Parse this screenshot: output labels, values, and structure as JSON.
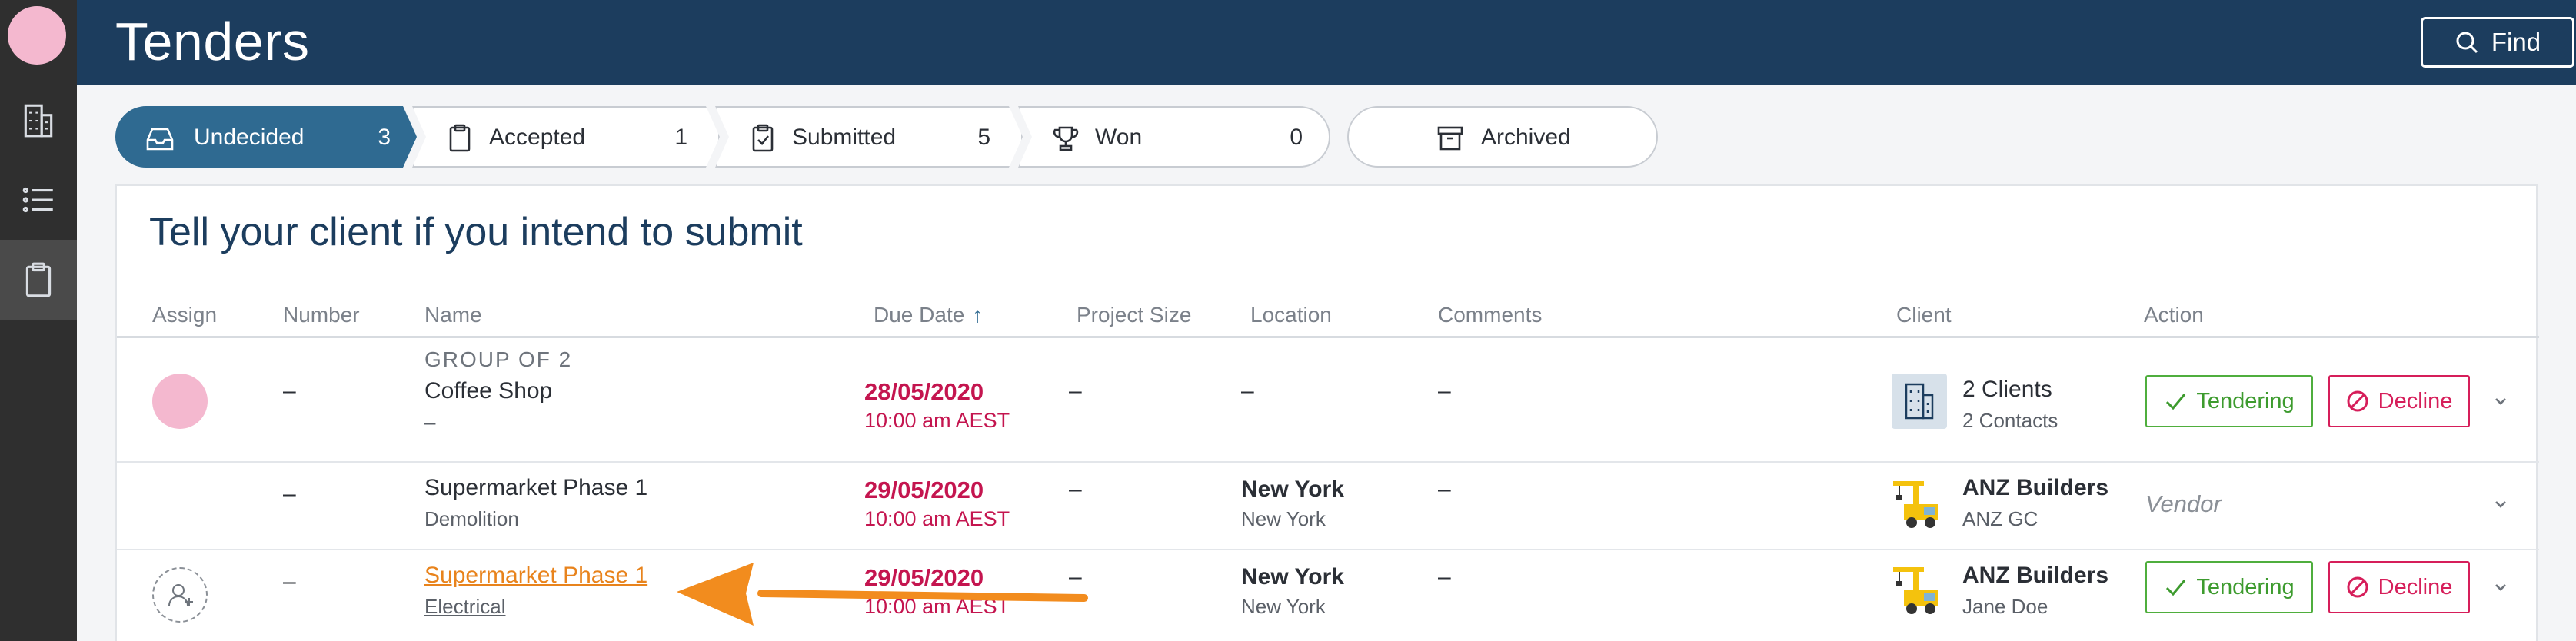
{
  "nav": {
    "icons": [
      "avatar",
      "building-icon",
      "list-icon",
      "clipboard-icon"
    ]
  },
  "header": {
    "title": "Tenders",
    "find_label": "Find"
  },
  "tabs": [
    {
      "label": "Undecided",
      "count": "3",
      "icon": "inbox-icon",
      "active": true
    },
    {
      "label": "Accepted",
      "count": "1",
      "icon": "clipboard-icon",
      "active": false
    },
    {
      "label": "Submitted",
      "count": "5",
      "icon": "clipboard-check-icon",
      "active": false
    },
    {
      "label": "Won",
      "count": "0",
      "icon": "trophy-icon",
      "active": false
    },
    {
      "label": "Archived",
      "count": "",
      "icon": "archive-icon",
      "active": false
    }
  ],
  "panel": {
    "title": "Tell your client if you intend to submit"
  },
  "columns": {
    "assign": "Assign",
    "number": "Number",
    "name": "Name",
    "due_date": "Due Date",
    "project_size": "Project Size",
    "location": "Location",
    "comments": "Comments",
    "client": "Client",
    "action": "Action"
  },
  "rows": [
    {
      "group_label": "GROUP OF 2",
      "number": "–",
      "name": "Coffee Shop",
      "name_sub": "–",
      "due_date": "28/05/2020",
      "due_time": "10:00 am AEST",
      "project_size": "–",
      "location": "–",
      "location_sub": "",
      "comments": "–",
      "client": "2 Clients",
      "client_sub": "2 Contacts",
      "tender_label": "Tendering",
      "decline_label": "Decline"
    },
    {
      "number": "–",
      "name": "Supermarket Phase 1",
      "name_sub": "Demolition",
      "due_date": "29/05/2020",
      "due_time": "10:00 am AEST",
      "project_size": "–",
      "location": "New York",
      "location_sub": "New York",
      "comments": "–",
      "client": "ANZ Builders",
      "client_sub": "ANZ GC",
      "vendor_label": "Vendor"
    },
    {
      "number": "–",
      "name": "Supermarket Phase 1",
      "name_sub": "Electrical",
      "due_date": "29/05/2020",
      "due_time": "10:00 am AEST",
      "project_size": "–",
      "location": "New York",
      "location_sub": "New York",
      "comments": "–",
      "client": "ANZ Builders",
      "client_sub": "Jane Doe",
      "tender_label": "Tendering",
      "decline_label": "Decline"
    }
  ],
  "colors": {
    "header_bg": "#1c3d5e",
    "active_tab": "#2f6a91",
    "due_red": "#c4154f",
    "tender_green": "#3d9b2e",
    "decline_pink": "#d61e5a",
    "annotation_orange": "#f28c1e"
  }
}
